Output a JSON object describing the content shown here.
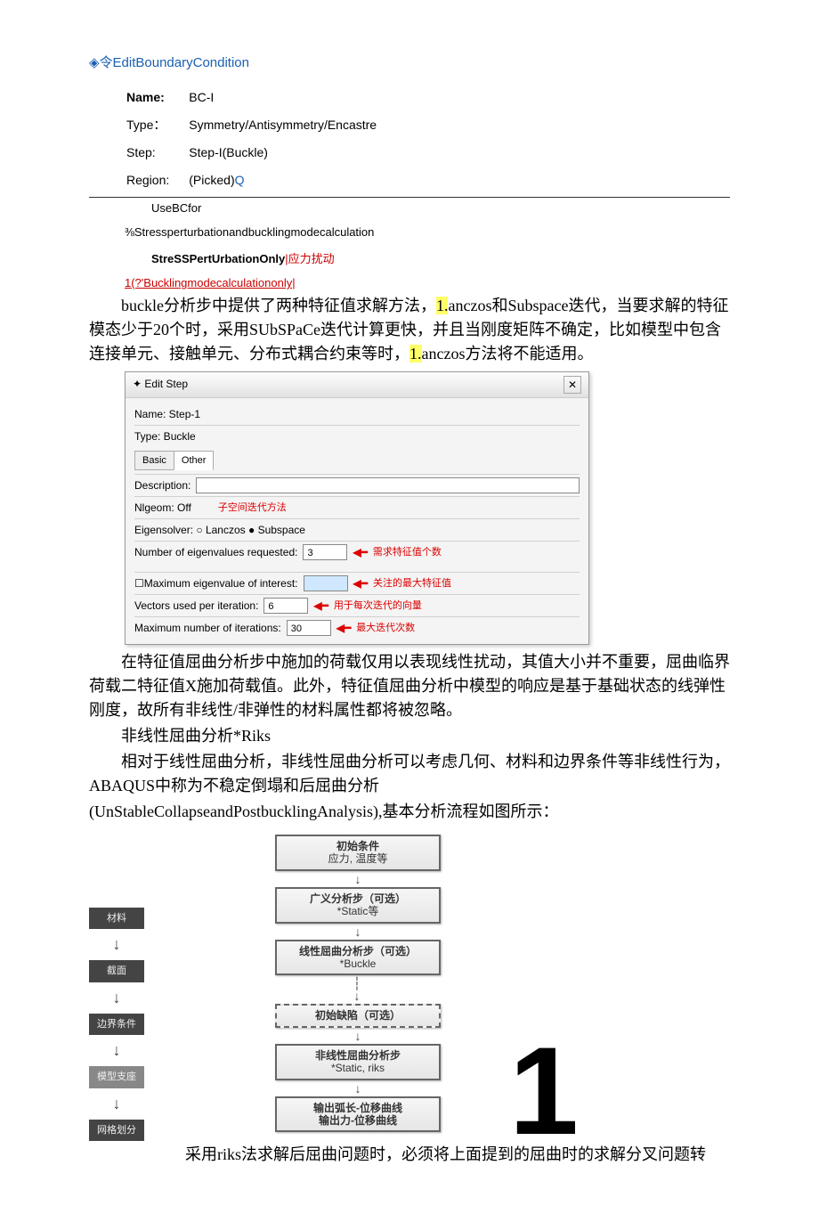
{
  "dialog": {
    "title": "令EditBoundaryCondition",
    "name_label": "Name:",
    "name_value": "BC-I",
    "type_label": "Type：",
    "type_value": "Symmetry/Antisymmetry/Encastre",
    "step_label": "Step:",
    "step_value": "Step-I(Buckle)",
    "region_label": "Region:",
    "region_value": "(Picked)",
    "region_q": "Q",
    "usebc": "UseBCfor",
    "option1": "⅜Stressperturbationandbucklingmodecalculation",
    "option2_bold": "StreSSPertUrbationOnly",
    "option2_rest": "|应力扰动",
    "option3": "1(?'Bucklingmodecalculationonly|"
  },
  "para1": {
    "t1": "buckle分析步中提供了两种特征值求解方法，",
    "h1": "1.",
    "t2": "anczos和Subspace迭代，当要求解的特征模态少于20个时，采用SUbSPaCe迭代计算更快，并且当刚度矩阵不确定，比如模型中包含连接单元、接触单元、分布式耦合约束等时，",
    "h2": "1.",
    "t3": "anczos方法将不能适用。"
  },
  "editstep": {
    "title": "Edit Step",
    "close": "✕",
    "name": "Name: Step-1",
    "type": "Type: Buckle",
    "tab_basic": "Basic",
    "tab_other": "Other",
    "desc_label": "Description:",
    "nlgeom": "Nlgeom: Off",
    "eigensolver": "Eigensolver: ○ Lanczos  ● Subspace",
    "sub_anno": "子空间迭代方法",
    "neig_label": "Number of eigenvalues requested:",
    "neig_val": "3",
    "neig_anno": "需求特征值个数",
    "maxeig_label": "Maximum eigenvalue of interest:",
    "maxeig_anno": "关注的最大特征值",
    "vec_label": "Vectors used per iteration:",
    "vec_val": "6",
    "vec_anno": "用于每次迭代的向量",
    "maxiter_label": "Maximum number of iterations:",
    "maxiter_val": "30",
    "maxiter_anno": "最大迭代次数"
  },
  "para2": "在特征值屈曲分析步中施加的荷载仅用以表现线性扰动，其值大小并不重要，屈曲临界荷载二特征值X施加荷载值。此外，特征值屈曲分析中模型的响应是基于基础状态的线弹性刚度，故所有非线性/非弹性的材料属性都将被忽略。",
  "para3": "非线性屈曲分析*Riks",
  "para4": "相对于线性屈曲分析，非线性屈曲分析可以考虑几何、材料和边界条件等非线性行为，ABAQUS中称为不稳定倒塌和后屈曲分析",
  "para5": "(UnStableCollapseandPostbucklingAnalysis),基本分析流程如图所示：",
  "flowchart": {
    "b1a": "初始条件",
    "b1b": "应力, 温度等",
    "b2a": "广义分析步（可选）",
    "b2b": "*Static等",
    "b3a": "线性屈曲分析步（可选）",
    "b3b": "*Buckle",
    "b4": "初始缺陷（可选）",
    "b5a": "非线性屈曲分析步",
    "b5b": "*Static, riks",
    "b6a": "输出弧长-位移曲线",
    "b6b": "输出力-位移曲线",
    "s1": "材料",
    "s2": "截面",
    "s3": "边界条件",
    "s4": "模型支座",
    "s5": "网格划分"
  },
  "big_one": "1",
  "para6": "采用riks法求解后屈曲问题时，必须将上面提到的屈曲时的求解分叉问题转"
}
